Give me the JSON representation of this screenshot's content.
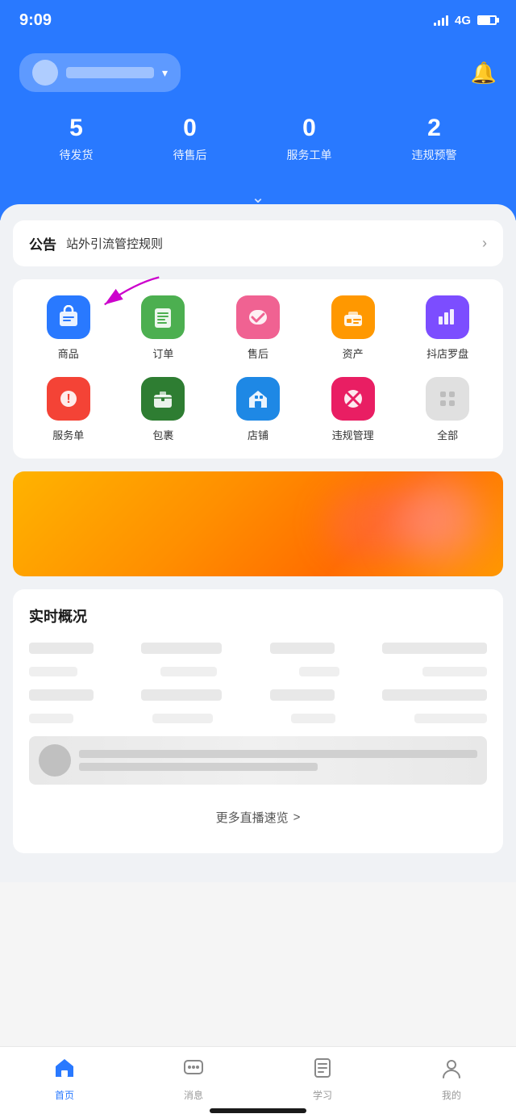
{
  "statusBar": {
    "time": "9:09",
    "signal": "4G"
  },
  "header": {
    "storeNameBlur": true,
    "bellLabel": "notifications"
  },
  "stats": [
    {
      "number": "5",
      "label": "待发货"
    },
    {
      "number": "0",
      "label": "待售后"
    },
    {
      "number": "0",
      "label": "服务工单"
    },
    {
      "number": "2",
      "label": "违规预警"
    }
  ],
  "announcement": {
    "tag": "公告",
    "text": "站外引流管控规则"
  },
  "menuItems": [
    {
      "label": "商品",
      "iconClass": "icon-blue",
      "icon": "🛍️"
    },
    {
      "label": "订单",
      "iconClass": "icon-green",
      "icon": "📋"
    },
    {
      "label": "售后",
      "iconClass": "icon-pink",
      "icon": "↩️"
    },
    {
      "label": "资产",
      "iconClass": "icon-orange",
      "icon": "📁"
    },
    {
      "label": "抖店罗盘",
      "iconClass": "icon-purple",
      "icon": "📊"
    },
    {
      "label": "服务单",
      "iconClass": "icon-red",
      "icon": "❗"
    },
    {
      "label": "包裹",
      "iconClass": "icon-dark-green",
      "icon": "📦"
    },
    {
      "label": "店铺",
      "iconClass": "icon-blue-house",
      "icon": "🏠"
    },
    {
      "label": "违规管理",
      "iconClass": "icon-pink-circle",
      "icon": "🚫"
    },
    {
      "label": "全部",
      "iconClass": "icon-gray",
      "icon": "⋯"
    }
  ],
  "realtimeSection": {
    "title": "实时概况"
  },
  "moreLivestream": {
    "text": "更多直播速览",
    "arrow": ">"
  },
  "bottomNav": [
    {
      "label": "首页",
      "active": true,
      "icon": "🏠"
    },
    {
      "label": "消息",
      "active": false,
      "icon": "💬"
    },
    {
      "label": "学习",
      "active": false,
      "icon": "📖"
    },
    {
      "label": "我的",
      "active": false,
      "icon": "👤"
    }
  ]
}
